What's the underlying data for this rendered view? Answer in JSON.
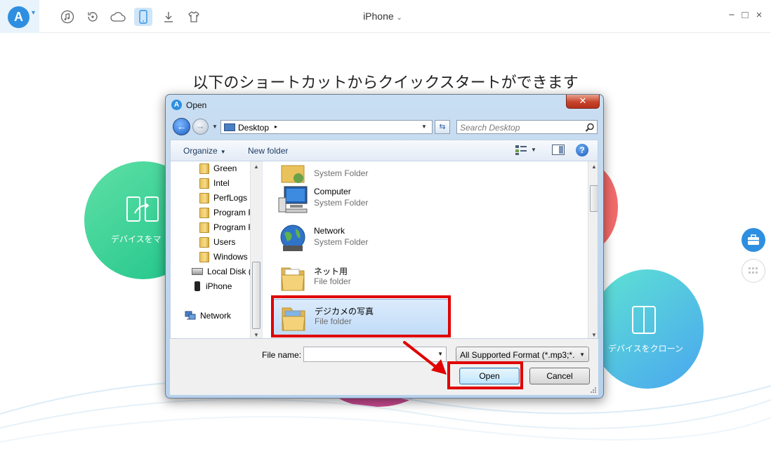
{
  "app": {
    "device_title": "iPhone",
    "logo_letter": "A",
    "headline": "以下のショートカットからクイックスタートができます",
    "toolbar_icons": [
      "music-icon",
      "restore-icon",
      "cloud-icon",
      "phone-icon",
      "download-icon",
      "shirt-icon"
    ],
    "active_toolbar_icon": "phone-icon",
    "accent": "#2e8fe0",
    "window_controls": [
      "−",
      "□",
      "×"
    ],
    "bubbles": {
      "left_label": "デバイスをマ",
      "right_label": "デバイスをクローン"
    }
  },
  "dialog": {
    "title": "Open",
    "close": "✕",
    "address": {
      "location": "Desktop",
      "arrow": "▸"
    },
    "search": {
      "placeholder": "Search Desktop"
    },
    "command_bar": {
      "organize": "Organize",
      "new_folder": "New folder",
      "caret": "▼"
    },
    "nav_tree": [
      {
        "label": "Green",
        "icon": "folder-icon"
      },
      {
        "label": "Intel",
        "icon": "folder-icon"
      },
      {
        "label": "PerfLogs",
        "icon": "folder-icon"
      },
      {
        "label": "Program F",
        "icon": "folder-icon"
      },
      {
        "label": "Program F",
        "icon": "folder-icon"
      },
      {
        "label": "Users",
        "icon": "folder-icon"
      },
      {
        "label": "Windows",
        "icon": "folder-icon"
      },
      {
        "label": "Local Disk (I",
        "icon": "disk-icon"
      },
      {
        "label": "iPhone",
        "icon": "phone-icon"
      },
      {
        "label": "Network",
        "icon": "network-icon"
      }
    ],
    "files": [
      {
        "name": "",
        "type": "System Folder",
        "icon": "user-folder-icon"
      },
      {
        "name": "Computer",
        "type": "System Folder",
        "icon": "computer-icon"
      },
      {
        "name": "Network",
        "type": "System Folder",
        "icon": "globe-icon"
      },
      {
        "name": "ネット用",
        "type": "File folder",
        "icon": "folder-icon"
      },
      {
        "name": "デジカメの写真",
        "type": "File folder",
        "icon": "folder-icon"
      }
    ],
    "selected_file": "デジカメの写真",
    "file_name": {
      "label": "File name:",
      "value": ""
    },
    "file_type": "All Supported Format (*.mp3;*.",
    "buttons": {
      "open": "Open",
      "cancel": "Cancel"
    },
    "highlight_color": "#e00000"
  }
}
